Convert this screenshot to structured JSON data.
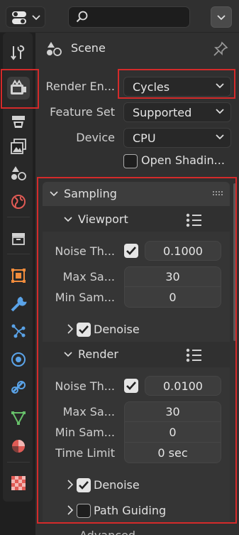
{
  "header": {
    "editor_type_icon": "properties-editor-icon",
    "search_placeholder": ""
  },
  "tabs": [
    {
      "name": "tool",
      "icon": "tool-icon",
      "color": "#d2d2d2"
    },
    {
      "name": "render",
      "icon": "render-icon",
      "color": "#d2d2d2",
      "active": true
    },
    {
      "name": "output",
      "icon": "output-icon",
      "color": "#d2d2d2"
    },
    {
      "name": "view-layer",
      "icon": "view-layer-icon",
      "color": "#d2d2d2"
    },
    {
      "name": "scene",
      "icon": "scene-icon",
      "color": "#d2d2d2"
    },
    {
      "name": "world",
      "icon": "world-icon",
      "color": "#e05b55"
    },
    {
      "name": "collection",
      "icon": "collection-icon",
      "color": "#d2d2d2"
    },
    {
      "name": "object",
      "icon": "object-icon",
      "color": "#f08c3c"
    },
    {
      "name": "modifiers",
      "icon": "wrench-icon",
      "color": "#5aa3e8"
    },
    {
      "name": "particles",
      "icon": "particles-icon",
      "color": "#5aa3e8"
    },
    {
      "name": "physics",
      "icon": "physics-icon",
      "color": "#5aa3e8"
    },
    {
      "name": "constraints",
      "icon": "constraints-icon",
      "color": "#5aa3e8"
    },
    {
      "name": "data",
      "icon": "mesh-data-icon",
      "color": "#67c06a"
    },
    {
      "name": "material",
      "icon": "material-icon",
      "color": "#e05b55"
    },
    {
      "name": "texture",
      "icon": "texture-icon",
      "color": "#e05b55"
    }
  ],
  "context": {
    "title": "Scene"
  },
  "render": {
    "engine_label": "Render En...",
    "engine_value": "Cycles",
    "feature_set_label": "Feature Set",
    "feature_set_value": "Supported",
    "device_label": "Device",
    "device_value": "CPU",
    "open_shading_label": "Open Shadin...",
    "open_shading_checked": false
  },
  "sampling": {
    "title": "Sampling",
    "viewport": {
      "title": "Viewport",
      "noise_label": "Noise Th...",
      "noise_checked": true,
      "noise_value": "0.1000",
      "max_label": "Max Sa...",
      "max_value": "30",
      "min_label": "Min Sam...",
      "min_value": "0",
      "denoise_label": "Denoise",
      "denoise_checked": true
    },
    "render": {
      "title": "Render",
      "noise_label": "Noise Th...",
      "noise_checked": true,
      "noise_value": "0.0100",
      "max_label": "Max Sa...",
      "max_value": "30",
      "min_label": "Min Sam...",
      "min_value": "0",
      "time_label": "Time Limit",
      "time_value": "0 sec",
      "denoise_label": "Denoise",
      "denoise_checked": true,
      "path_guiding_label": "Path Guiding",
      "path_guiding_checked": false
    },
    "next_label": "Advanced"
  },
  "colors": {
    "highlight": "#d42a2a",
    "checkbox_on": "#e5e5e5"
  }
}
